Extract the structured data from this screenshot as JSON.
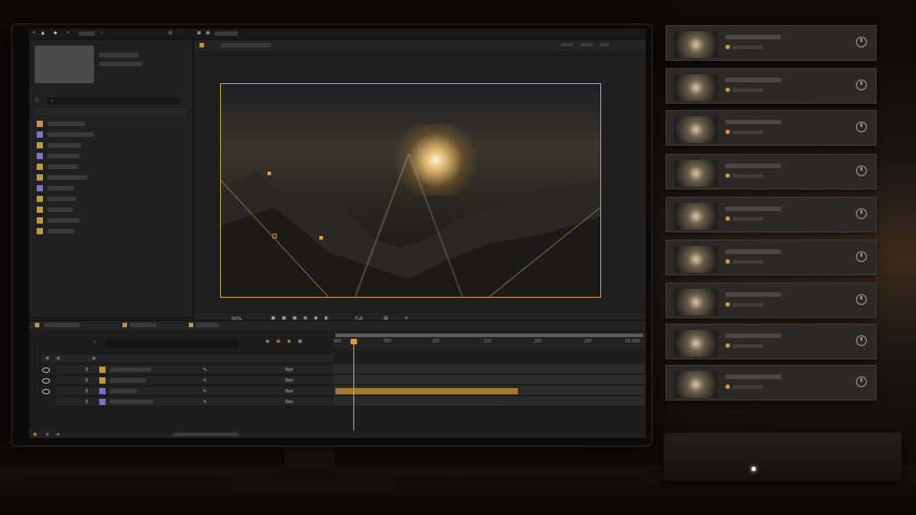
{
  "viewer": {
    "zoom_label": "50%",
    "res_label": "Full"
  },
  "timeline": {
    "ruler_labels": [
      "00f",
      "05f",
      "10f",
      "15f",
      "20f",
      "25f",
      "01:00f"
    ],
    "layers": [
      {
        "num": "3",
        "mode": "Nor"
      },
      {
        "num": "3",
        "mode": "Nor"
      },
      {
        "num": "3",
        "mode": "Nor"
      },
      {
        "num": "3",
        "mode": "Nor"
      }
    ]
  },
  "project": {
    "item_icons": [
      "folder",
      "comp",
      "folder",
      "comp",
      "folder",
      "folder",
      "comp",
      "folder",
      "folder",
      "folder",
      "folder"
    ]
  },
  "render_queue": {
    "cards": 9
  },
  "colors": {
    "accent": "#d9a035",
    "playhead": "#d9a035",
    "clip": "#a07a30"
  }
}
